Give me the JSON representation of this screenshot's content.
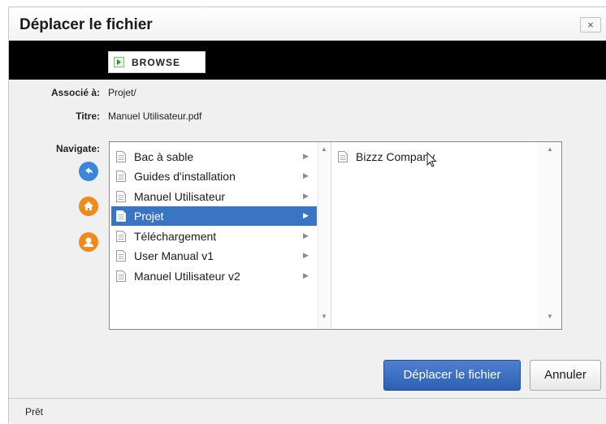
{
  "dialog": {
    "title": "Déplacer le fichier",
    "close_label": "×"
  },
  "toolbar": {
    "browse_label": "BROWSE"
  },
  "fields": {
    "associe_label": "Associé à:",
    "associe_value": "Projet/",
    "titre_label": "Titre:",
    "titre_value": "Manuel Utilisateur.pdf",
    "navigate_label": "Navigate:"
  },
  "browser": {
    "column1": [
      {
        "label": "Bac à sable",
        "selected": false
      },
      {
        "label": "Guides d'installation",
        "selected": false
      },
      {
        "label": "Manuel Utilisateur",
        "selected": false
      },
      {
        "label": "Projet",
        "selected": true
      },
      {
        "label": "Téléchargement",
        "selected": false
      },
      {
        "label": "User Manual v1",
        "selected": false
      },
      {
        "label": "Manuel Utilisateur v2",
        "selected": false
      }
    ],
    "column2": [
      {
        "label": "Bizzz Company"
      }
    ]
  },
  "actions": {
    "move_label": "Déplacer le fichier",
    "cancel_label": "Annuler"
  },
  "status": {
    "text": "Prêt"
  },
  "colors": {
    "selected_row": "#3a75c4",
    "primary_button": "#2d60b4",
    "nav_back": "#3a86d8",
    "nav_home": "#f08a1c",
    "nav_user": "#f08a1c"
  },
  "icons": {
    "browse": "browse-icon",
    "back": "back-arrow-icon",
    "home": "home-icon",
    "user": "user-icon",
    "document": "document-icon",
    "chevron": "chevron-right-icon"
  }
}
